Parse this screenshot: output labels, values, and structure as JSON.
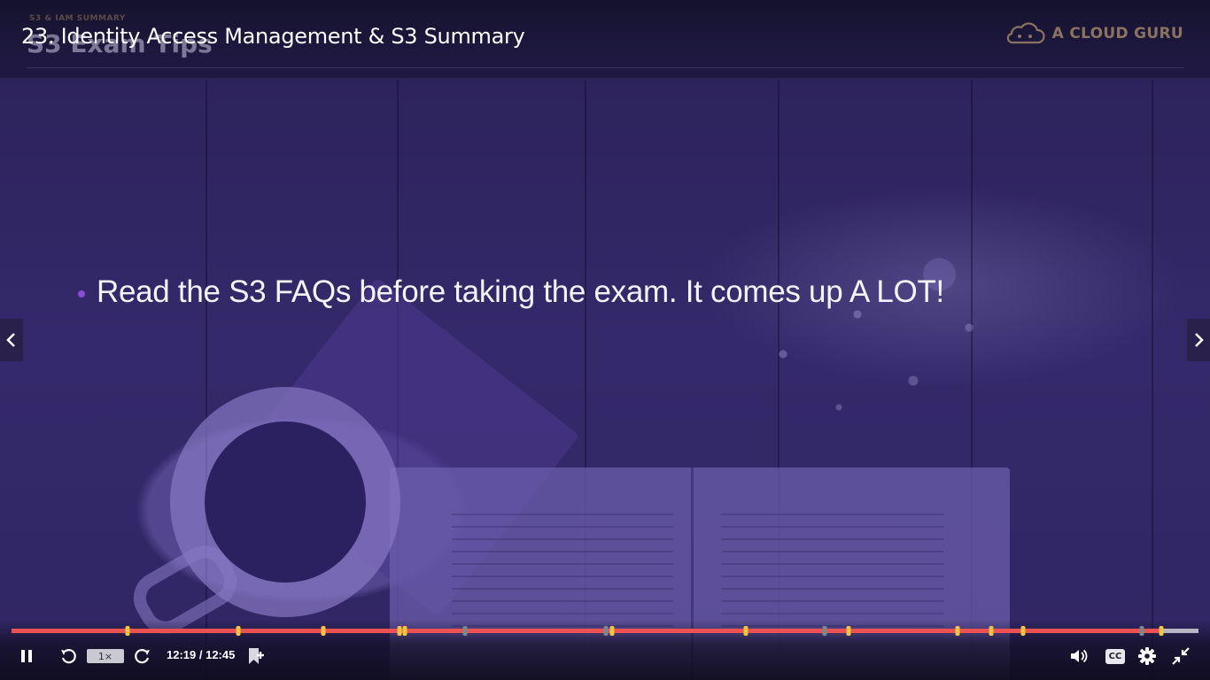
{
  "player": {
    "lecture_title": "23. Identity Access Management & S3 Summary",
    "speed_label": "1×",
    "time_display": "12:19 / 12:45",
    "progress": 0.967,
    "colors": {
      "progress": "#ec5252",
      "track": "#b8b6c4",
      "bookmark": "#f4c542",
      "bookmark_muted": "#7a8a8c",
      "accent": "#8a4dd8"
    },
    "bookmarks": [
      {
        "pos": 0.098,
        "kind": "note"
      },
      {
        "pos": 0.191,
        "kind": "note"
      },
      {
        "pos": 0.263,
        "kind": "note"
      },
      {
        "pos": 0.327,
        "kind": "note"
      },
      {
        "pos": 0.331,
        "kind": "note"
      },
      {
        "pos": 0.382,
        "kind": "muted"
      },
      {
        "pos": 0.501,
        "kind": "muted"
      },
      {
        "pos": 0.506,
        "kind": "note"
      },
      {
        "pos": 0.619,
        "kind": "note"
      },
      {
        "pos": 0.685,
        "kind": "muted"
      },
      {
        "pos": 0.705,
        "kind": "note"
      },
      {
        "pos": 0.797,
        "kind": "note"
      },
      {
        "pos": 0.825,
        "kind": "note"
      },
      {
        "pos": 0.852,
        "kind": "note"
      },
      {
        "pos": 0.952,
        "kind": "muted"
      },
      {
        "pos": 0.969,
        "kind": "note"
      }
    ],
    "icons": {
      "pause": "pause-icon",
      "rewind": "rewind-5-icon",
      "forward": "forward-5-icon",
      "add_bookmark": "add-bookmark-icon",
      "volume": "volume-icon",
      "captions": "captions-icon",
      "settings": "settings-icon",
      "exit_fullscreen": "exit-fullscreen-icon",
      "prev": "chevron-left-icon",
      "next": "chevron-right-icon"
    },
    "captions_label": "CC"
  },
  "slide": {
    "kicker": "S3 & IAM SUMMARY",
    "title": "S3 Exam Tips",
    "brand": "A CLOUD GURU",
    "bullet": "Read the S3 FAQs before taking the exam. It comes up A LOT!"
  }
}
